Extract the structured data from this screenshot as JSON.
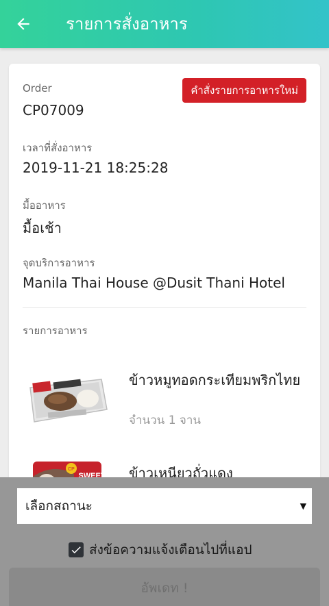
{
  "appbar": {
    "title": "รายการสั่งอาหาร",
    "back_icon": "arrow-left-icon"
  },
  "order": {
    "order_label": "Order",
    "order_id": "CP07009",
    "status_badge": "คำสั่งรายการอาหารใหม่",
    "status_color": "#d32027",
    "time_label": "เวลาที่สั่งอาหาร",
    "time_value": "2019-11-21 18:25:28",
    "meal_label": "มื้ออาหาร",
    "meal_value": "มื้อเช้า",
    "location_label": "จุดบริการอาหาร",
    "location_value": "Manila Thai House @Dusit Thani Hotel",
    "items_label": "รายการอาหาร"
  },
  "items": [
    {
      "name": "ข้าวหมูทอดกระเทียมพริกไทย",
      "qty": "จำนวน 1 จาน"
    },
    {
      "name": "ข้าวเหนียวถั่วแดง",
      "logo_text": "SWEET"
    }
  ],
  "bottom": {
    "select_value": "เลือกสถานะ",
    "notify_label": "ส่งข้อความแจ้งเตือนไปที่แอป",
    "notify_checked": true,
    "update_button": "อัพเดท !"
  },
  "colors": {
    "appbar_start": "#34d29a",
    "appbar_end": "#33c3c9"
  }
}
